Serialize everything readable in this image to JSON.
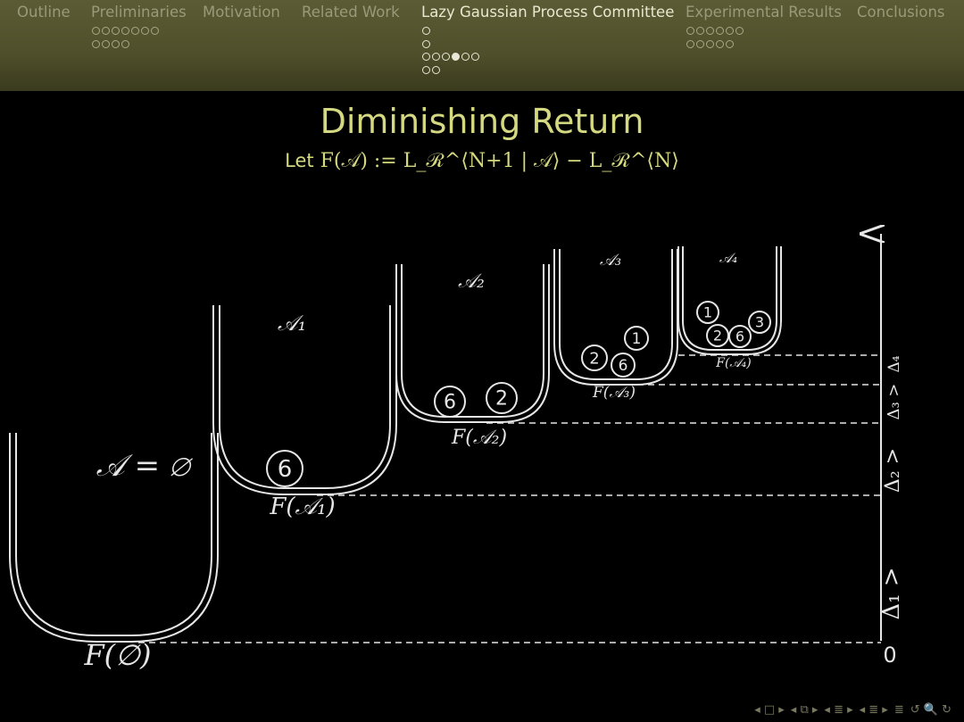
{
  "headline": {
    "sections": [
      {
        "label": "Outline",
        "active": false,
        "rows": []
      },
      {
        "label": "Preliminaries",
        "active": false,
        "rows": [
          7,
          4
        ]
      },
      {
        "label": "Motivation",
        "active": false,
        "rows": []
      },
      {
        "label": "Related Work",
        "active": false,
        "rows": []
      },
      {
        "label": "Lazy Gaussian Process Committee",
        "active": true,
        "rows": [
          1,
          1,
          6,
          2
        ]
      },
      {
        "label": "Experimental Results",
        "active": false,
        "rows": [
          6,
          5
        ]
      },
      {
        "label": "Conclusions",
        "active": false,
        "rows": []
      }
    ],
    "current_slide_row": 2,
    "current_slide_index": 3
  },
  "slide": {
    "title": "Diminishing Return",
    "subtitle_prefix": "Let",
    "subtitle_formula": "F(𝒜) := L_ℛ^⟨N+1 | 𝒜⟩ − L_ℛ^⟨N⟩"
  },
  "diagram": {
    "set_labels": [
      "𝒜 = ∅",
      "𝒜₁",
      "𝒜₂",
      "𝒜₃",
      "𝒜₄"
    ],
    "f_labels": [
      "F(∅)",
      "F(𝒜₁)",
      "F(𝒜₂)",
      "F(𝒜₃)",
      "F(𝒜₄)"
    ],
    "balls": {
      "cup1": [
        "6"
      ],
      "cup2": [
        "6",
        "2"
      ],
      "cup3": [
        "2",
        "6",
        "1"
      ],
      "cup4": [
        "1",
        "2",
        "6",
        "3"
      ]
    },
    "axis_zero": "0",
    "delta_labels": [
      "Δ₁ >",
      "Δ₂ >",
      "Δ₃ >",
      "Δ₄"
    ]
  },
  "navbar": {
    "icons": [
      "◂ □ ▸",
      "◂ ⧉ ▸",
      "◂ ≣ ▸",
      "◂ ≣ ▸",
      "≣",
      "↺ 🔍 ↻"
    ]
  },
  "colors": {
    "title": "#d4d880",
    "headline_bg": "#4f4f2b",
    "line": "#e6e6e6"
  }
}
